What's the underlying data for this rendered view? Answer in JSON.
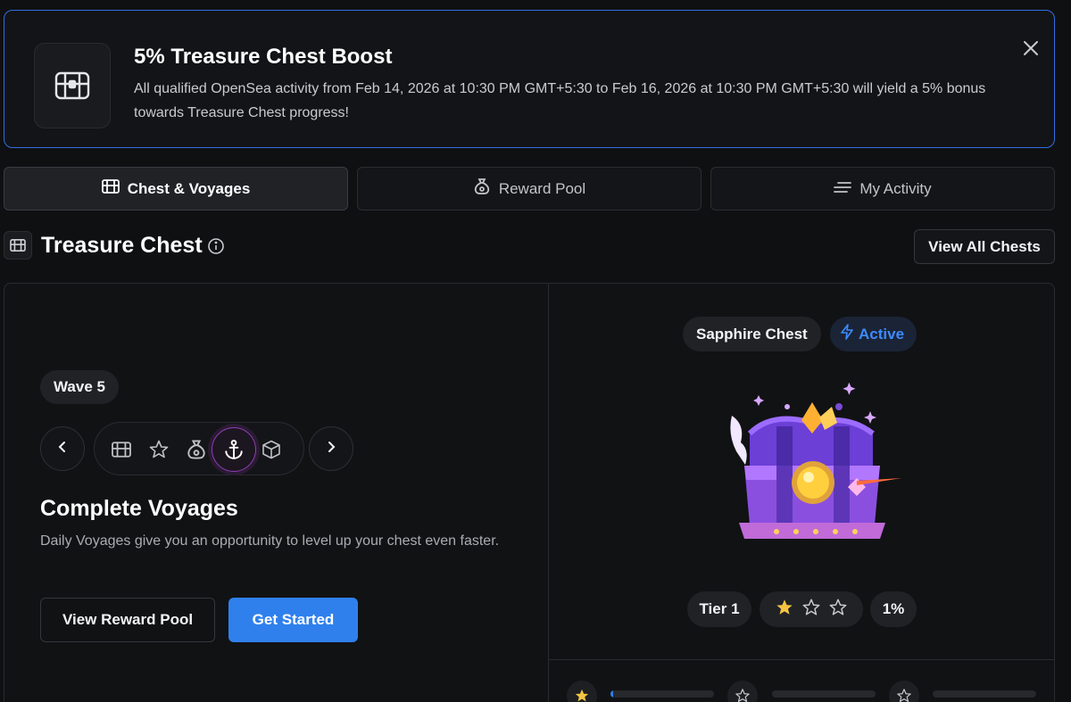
{
  "banner": {
    "title": "5% Treasure Chest Boost",
    "description": "All qualified OpenSea activity from Feb 14, 2026 at 10:30 PM GMT+5:30 to Feb 16, 2026 at 10:30 PM GMT+5:30 will yield a 5% bonus towards Treasure Chest progress!",
    "icon": "treasure-chest-icon",
    "close_icon": "close-icon"
  },
  "tabs": [
    {
      "label": "Chest & Voyages",
      "icon": "chest-icon",
      "active": true
    },
    {
      "label": "Reward Pool",
      "icon": "money-bag-icon",
      "active": false
    },
    {
      "label": "My Activity",
      "icon": "list-icon",
      "active": false
    }
  ],
  "section": {
    "title": "Treasure Chest",
    "view_all_label": "View All Chests"
  },
  "voyage": {
    "wave_label": "Wave 5",
    "strip_icons": [
      "chest-icon",
      "star-icon",
      "money-bag-icon",
      "anchor-icon",
      "box-icon"
    ],
    "active_icon_index": 3,
    "title": "Complete Voyages",
    "description": "Daily Voyages give you an opportunity to level up your chest even faster.",
    "secondary_button": "View Reward Pool",
    "primary_button": "Get Started"
  },
  "chest": {
    "name": "Sapphire Chest",
    "status": "Active",
    "tier_label": "Tier 1",
    "stars_filled": 1,
    "stars_total": 3,
    "progress_label": "1%",
    "progress_bars": [
      0.03,
      0,
      0
    ]
  },
  "colors": {
    "accent": "#2f80ed",
    "active_text": "#3d8bff",
    "star": "#f5c542",
    "border_highlight": "#2f6fe0"
  }
}
